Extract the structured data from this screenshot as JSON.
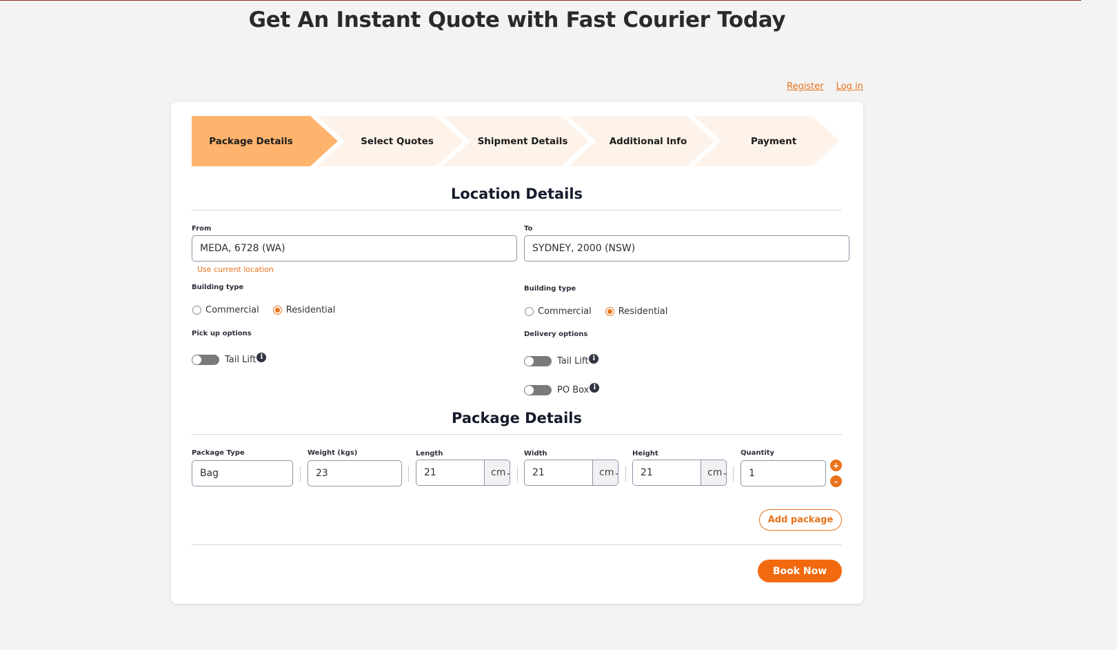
{
  "page": {
    "title": "Get An Instant Quote with Fast Courier Today"
  },
  "auth": {
    "register": "Register",
    "login": "Log in"
  },
  "steps": [
    "Package Details",
    "Select Quotes",
    "Shipment Details",
    "Additional Info",
    "Payment"
  ],
  "location": {
    "title": "Location Details",
    "from_label": "From",
    "from_value": "MEDA, 6728 (WA)",
    "to_label": "To",
    "to_value": "SYDNEY, 2000 (NSW)",
    "use_current": "Use current location",
    "building_type_label": "Building type",
    "commercial": "Commercial",
    "residential": "Residential",
    "pickup_label": "Pick up options",
    "delivery_label": "Delivery options",
    "tail_lift": "Tail Lift",
    "po_box": "PO Box"
  },
  "package": {
    "title": "Package Details",
    "type_label": "Package Type",
    "type_value": "Bag",
    "weight_label": "Weight (kgs)",
    "weight_value": "23",
    "length_label": "Length",
    "length_value": "21",
    "width_label": "Width",
    "width_value": "21",
    "height_label": "Height",
    "height_value": "21",
    "unit": "cm",
    "quantity_label": "Quantity",
    "quantity_value": "1",
    "plus": "+",
    "minus": "-",
    "add_package": "Add package",
    "book_now": "Book Now"
  },
  "colors": {
    "accent": "#e8711a",
    "step_active": "#ffb46e",
    "step_inactive": "#fef3ea"
  },
  "icons": {
    "info": "info-icon",
    "select": "chevron-down-icon"
  }
}
